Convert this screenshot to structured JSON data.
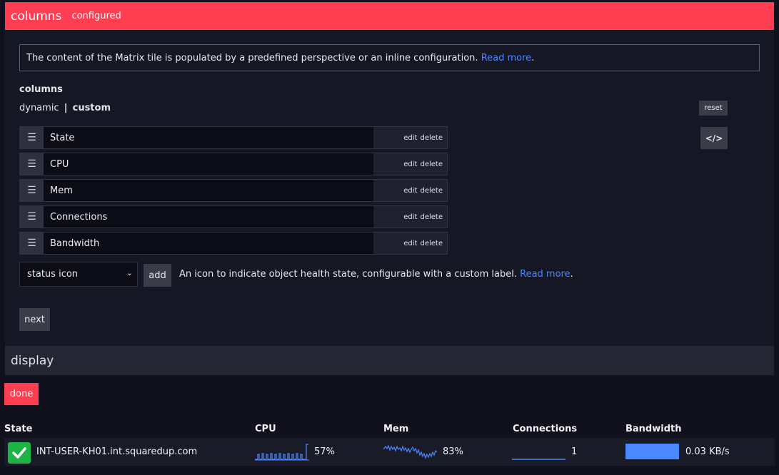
{
  "columns_section": {
    "title": "columns",
    "status": "configured"
  },
  "info": {
    "text": "The content of the Matrix tile is populated by a predefined perspective or an inline configuration.",
    "link": "Read more",
    "suffix": "."
  },
  "columns_label": "columns",
  "mode": {
    "dynamic": "dynamic",
    "separator": "|",
    "custom": "custom"
  },
  "reset_label": "reset",
  "code_label": "</>",
  "column_rows": [
    {
      "name": "State",
      "edit": "edit",
      "delete": "delete"
    },
    {
      "name": "CPU",
      "edit": "edit",
      "delete": "delete"
    },
    {
      "name": "Mem",
      "edit": "edit",
      "delete": "delete"
    },
    {
      "name": "Connections",
      "edit": "edit",
      "delete": "delete"
    },
    {
      "name": "Bandwidth",
      "edit": "edit",
      "delete": "delete"
    }
  ],
  "add_row": {
    "selected": "status icon",
    "add_label": "add",
    "description": "An icon to indicate object health state, configurable with a custom label.",
    "link": "Read more",
    "suffix": "."
  },
  "next_label": "next",
  "display_section": {
    "title": "display"
  },
  "done_label": "done",
  "matrix": {
    "headers": [
      "State",
      "CPU",
      "Mem",
      "Connections",
      "Bandwidth"
    ],
    "row": {
      "state": "healthy",
      "host": "INT-USER-KH01.int.squaredup.com",
      "cpu": "57%",
      "mem": "83%",
      "connections": "1",
      "bandwidth": "0.03 KB/s"
    }
  },
  "colors": {
    "accent": "#ff3e52",
    "link": "#4d86ff",
    "ok": "#1db446",
    "spark": "#4b87ff"
  },
  "icons": {
    "handle": "drag-handle-icon",
    "chevron": "chevron-down-icon",
    "check": "check-icon"
  }
}
